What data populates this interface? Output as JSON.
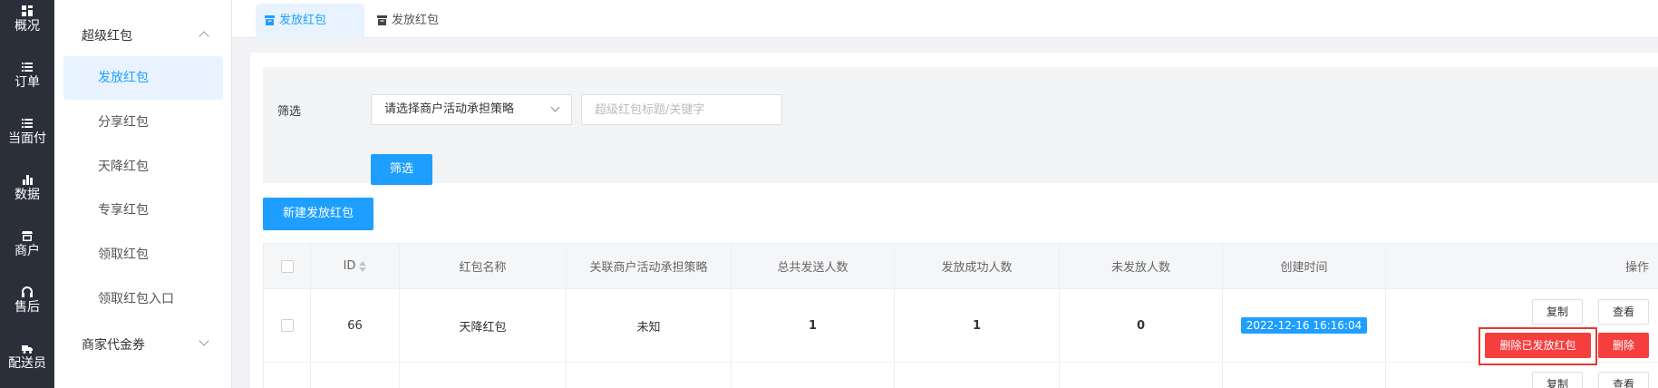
{
  "iconbar": {
    "items": [
      {
        "label": "概况",
        "icon": "dashboard-icon"
      },
      {
        "label": "订单",
        "icon": "list-icon"
      },
      {
        "label": "当面付",
        "icon": "list-icon"
      },
      {
        "label": "数据",
        "icon": "bar-chart-icon"
      },
      {
        "label": "商户",
        "icon": "store-icon"
      },
      {
        "label": "售后",
        "icon": "headset-icon"
      },
      {
        "label": "配送员",
        "icon": "delivery-icon"
      }
    ]
  },
  "submenu": {
    "group1": "超级红包",
    "items": [
      {
        "label": "发放红包",
        "active": true
      },
      {
        "label": "分享红包",
        "active": false
      },
      {
        "label": "天降红包",
        "active": false
      },
      {
        "label": "专享红包",
        "active": false
      },
      {
        "label": "领取红包",
        "active": false
      },
      {
        "label": "领取红包入口",
        "active": false
      }
    ],
    "group2": "商家代金券"
  },
  "tabs": [
    {
      "label": "发放红包",
      "active": true
    },
    {
      "label": "发放红包",
      "active": false
    }
  ],
  "filter": {
    "label": "筛选",
    "select_value": "请选择商户活动承担策略",
    "keyword_placeholder": "超级红包标题/关键字",
    "button": "筛选"
  },
  "new_button": "新建发放红包",
  "table": {
    "headers": [
      "ID",
      "红包名称",
      "关联商户活动承担策略",
      "总共发送人数",
      "发放成功人数",
      "未发放人数",
      "创建时间",
      "操作"
    ],
    "rows": [
      {
        "id": "66",
        "name": "天降红包",
        "strategy": "未知",
        "total_sent": "1",
        "success": "1",
        "not_sent": "0",
        "created": "2022-12-16 16:16:04",
        "actions": {
          "copy": "复制",
          "view": "查看",
          "delete_sent": "删除已发放红包",
          "delete": "删除"
        }
      },
      {
        "actions": {
          "copy": "复制",
          "view": "查看"
        }
      }
    ]
  },
  "colors": {
    "primary": "#1e9fff",
    "danger": "#f53f3f",
    "success": "#3ab54a",
    "sidebar": "#2b2f3a"
  }
}
